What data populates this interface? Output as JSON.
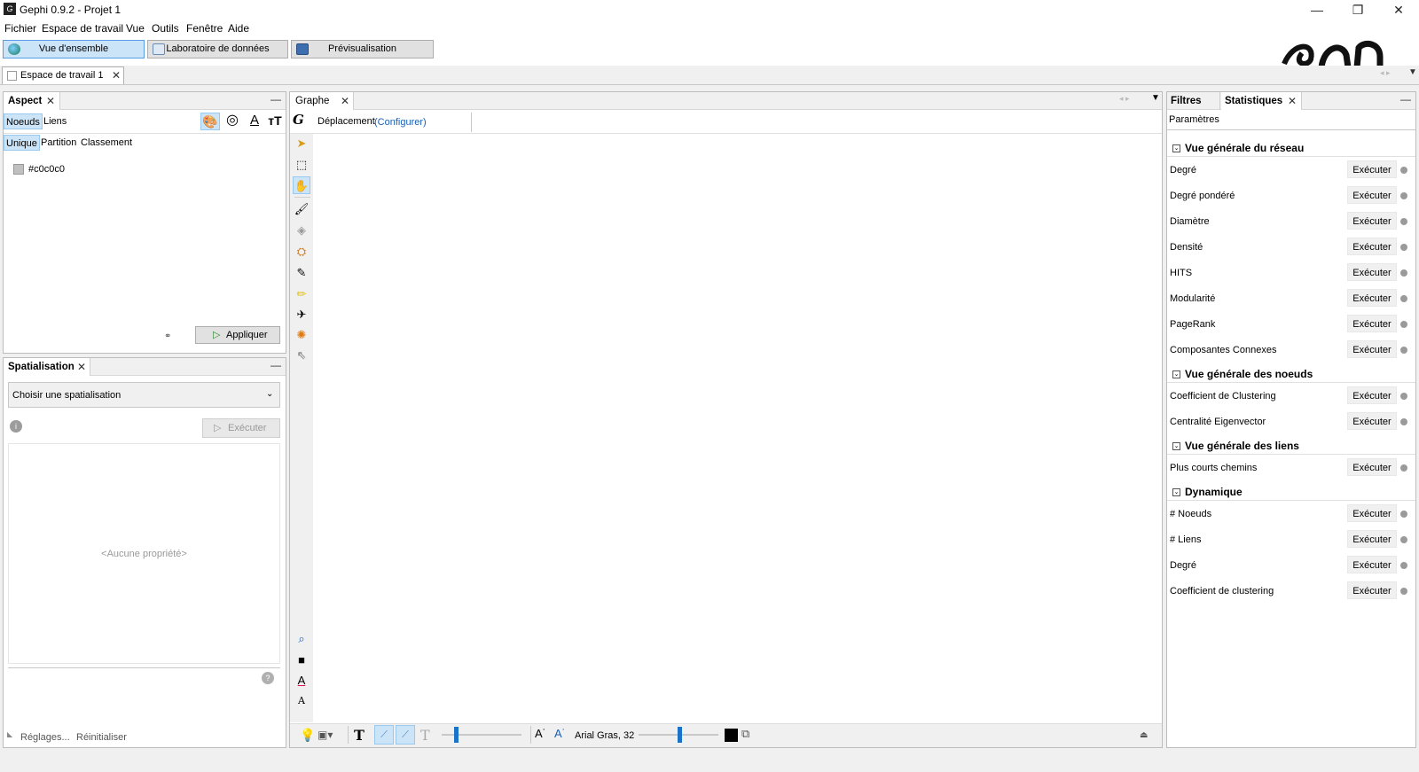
{
  "window": {
    "title": "Gephi 0.9.2 - Projet 1",
    "controls": [
      "—",
      "❐",
      "✕"
    ]
  },
  "menu": [
    "Fichier",
    "Espace de travail",
    "Vue",
    "Outils",
    "Fenêtre",
    "Aide"
  ],
  "switcher": {
    "overview": "Vue d'ensemble",
    "data_lab": "Laboratoire de données",
    "preview": "Prévisualisation"
  },
  "workspace_tab": "Espace de travail 1",
  "aspect": {
    "title": "Aspect",
    "tabs": [
      "Noeuds",
      "Liens"
    ],
    "modes": [
      "Unique",
      "Partition",
      "Classement"
    ],
    "color_value": "#c0c0c0",
    "apply": "Appliquer",
    "icons": [
      "palette-icon",
      "size-icon",
      "label-color-icon",
      "label-size-icon"
    ]
  },
  "layout": {
    "title": "Spatialisation",
    "select_placeholder": "Choisir une spatialisation",
    "run": "Exécuter",
    "no_property": "<Aucune propriété>",
    "settings": "Réglages...",
    "reset": "Réinitialiser"
  },
  "graph": {
    "tab": "Graphe",
    "mode": "Déplacement",
    "configure": "(Configurer)",
    "font_label": "Arial Gras, 32"
  },
  "right": {
    "tabs": [
      "Filtres",
      "Statistiques"
    ],
    "params": "Paramètres",
    "run_label": "Exécuter",
    "sections": [
      {
        "title": "Vue générale du réseau",
        "items": [
          "Degré",
          "Degré pondéré",
          "Diamètre",
          "Densité",
          "HITS",
          "Modularité",
          "PageRank",
          "Composantes Connexes"
        ]
      },
      {
        "title": "Vue générale des noeuds",
        "items": [
          "Coefficient de Clustering",
          "Centralité Eigenvector"
        ]
      },
      {
        "title": "Vue générale des liens",
        "items": [
          "Plus courts chemins"
        ]
      },
      {
        "title": "Dynamique",
        "items": [
          "# Noeuds",
          "# Liens",
          "Degré",
          "Coefficient de clustering"
        ]
      }
    ]
  },
  "colors": {
    "accent": "#cce4f7",
    "accent_border": "#569de5",
    "link": "#1a5fb4",
    "node_color": "#c0c0c0"
  }
}
